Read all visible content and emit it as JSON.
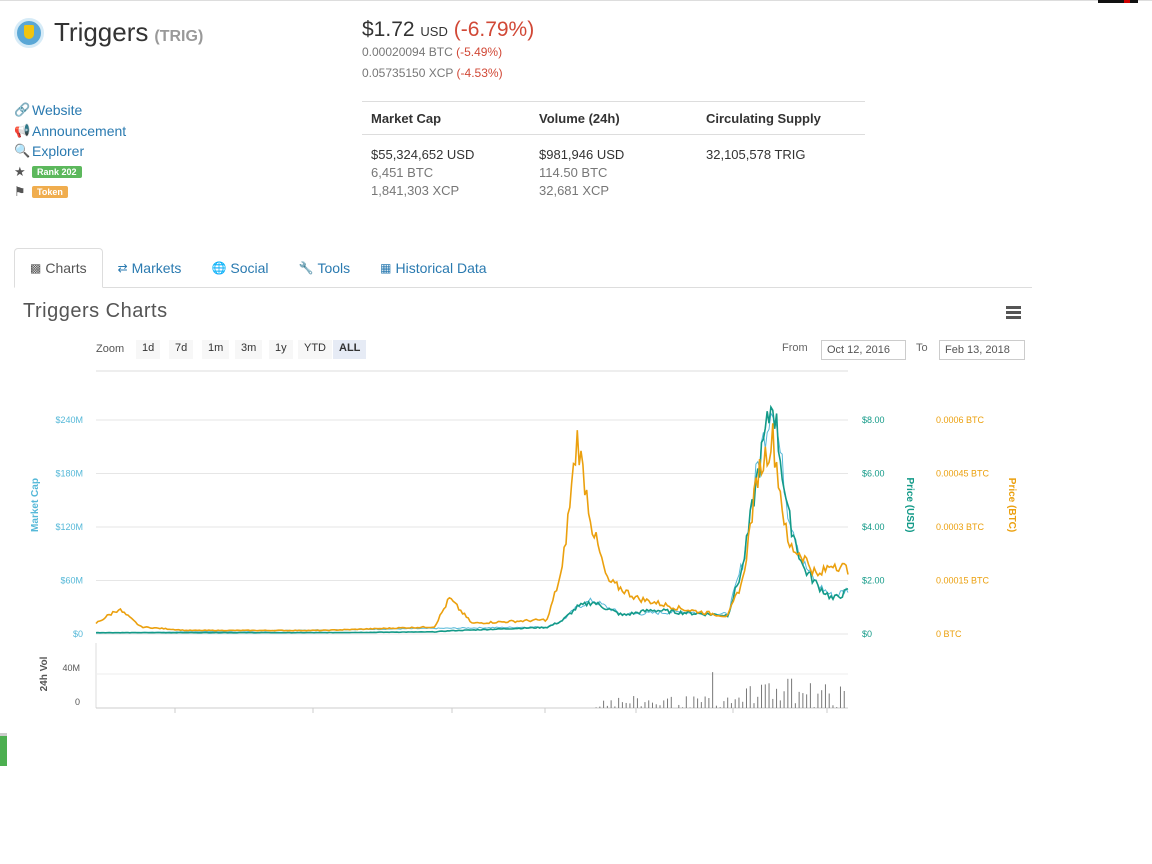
{
  "coin": {
    "name": "Triggers",
    "symbol": "(TRIG)"
  },
  "price": {
    "usd": "$1.72",
    "usd_unit": "USD",
    "usd_change": "(-6.79%)",
    "btc": "0.00020094 BTC",
    "btc_change": "(-5.49%)",
    "xcp": "0.05735150 XCP",
    "xcp_change": "(-4.53%)"
  },
  "links": {
    "website": "Website",
    "announcement": "Announcement",
    "explorer": "Explorer",
    "rank": "Rank 202",
    "token": "Token"
  },
  "stats": {
    "headers": [
      "Market Cap",
      "Volume (24h)",
      "Circulating Supply"
    ],
    "market_cap": [
      "$55,324,652 USD",
      "6,451 BTC",
      "1,841,303 XCP"
    ],
    "volume": [
      "$981,946 USD",
      "114.50 BTC",
      "32,681 XCP"
    ],
    "supply": [
      "32,105,578 TRIG"
    ]
  },
  "tabs": [
    "Charts",
    "Markets",
    "Social",
    "Tools",
    "Historical Data"
  ],
  "chart_title": "Triggers Charts",
  "zoom": {
    "label": "Zoom",
    "buttons": [
      "1d",
      "7d",
      "1m",
      "3m",
      "1y",
      "YTD",
      "ALL"
    ],
    "active": "ALL"
  },
  "range": {
    "from_label": "From",
    "from": "Oct 12, 2016",
    "to_label": "To",
    "to": "Feb 13, 2018"
  },
  "colors": {
    "market_cap": "#55b8d8",
    "price_usd": "#139a88",
    "price_btc": "#eba00e",
    "volume": "#777777",
    "link": "#2a7ab0",
    "negative": "#d14836"
  },
  "chart_data": {
    "type": "line",
    "x_range": [
      "Oct 12, 2016",
      "Feb 13, 2018"
    ],
    "axes": {
      "market_cap": {
        "label": "Market Cap",
        "ticks": [
          "$0",
          "$60M",
          "$120M",
          "$180M",
          "$240M"
        ],
        "range": [
          0,
          240000000
        ]
      },
      "price_usd": {
        "label": "Price (USD)",
        "ticks": [
          "$0",
          "$2.00",
          "$4.00",
          "$6.00",
          "$8.00"
        ],
        "range": [
          0,
          8
        ]
      },
      "price_btc": {
        "label": "Price (BTC)",
        "ticks": [
          "0 BTC",
          "0.00015 BTC",
          "0.0003 BTC",
          "0.00045 BTC",
          "0.0006 BTC"
        ],
        "range": [
          0,
          0.0006
        ]
      },
      "volume": {
        "label": "24h Vol",
        "ticks": [
          "0",
          "40M"
        ]
      }
    },
    "series": [
      {
        "name": "Price (USD)",
        "x": [
          0,
          0.06,
          0.12,
          0.3,
          0.45,
          0.47,
          0.6,
          0.62,
          0.64,
          0.66,
          0.7,
          0.74,
          0.78,
          0.84,
          0.86,
          0.88,
          0.9,
          0.92,
          0.94,
          0.96,
          0.98,
          1.0
        ],
        "values": [
          0.05,
          0.05,
          0.05,
          0.05,
          0.08,
          0.12,
          0.25,
          0.5,
          1.0,
          1.2,
          0.7,
          0.9,
          0.8,
          0.7,
          2.5,
          6.0,
          8.8,
          4.5,
          2.5,
          1.8,
          1.3,
          1.6
        ]
      },
      {
        "name": "Price (BTC)",
        "x": [
          0,
          0.03,
          0.06,
          0.12,
          0.3,
          0.45,
          0.47,
          0.5,
          0.6,
          0.62,
          0.64,
          0.66,
          0.68,
          0.72,
          0.78,
          0.84,
          0.86,
          0.88,
          0.9,
          0.92,
          0.94,
          0.96,
          0.98,
          1.0
        ],
        "values": [
          3e-05,
          7e-05,
          2e-05,
          1e-05,
          1e-05,
          2e-05,
          0.0001,
          3e-05,
          4e-05,
          0.00018,
          0.00055,
          0.0003,
          0.00015,
          0.0001,
          7e-05,
          5e-05,
          0.00015,
          0.00045,
          0.00055,
          0.00025,
          0.00022,
          0.00016,
          0.0002,
          0.00018
        ]
      },
      {
        "name": "Market Cap",
        "x": [
          0,
          0.6,
          0.62,
          0.64,
          0.66,
          0.7,
          0.78,
          0.84,
          0.86,
          0.88,
          0.9,
          0.92,
          0.94,
          0.96,
          0.98,
          1.0
        ],
        "values": [
          1000000,
          8000000,
          15000000,
          30000000,
          38000000,
          22000000,
          25000000,
          22000000,
          80000000,
          190000000,
          265000000,
          140000000,
          80000000,
          55000000,
          42000000,
          50000000
        ]
      }
    ]
  }
}
